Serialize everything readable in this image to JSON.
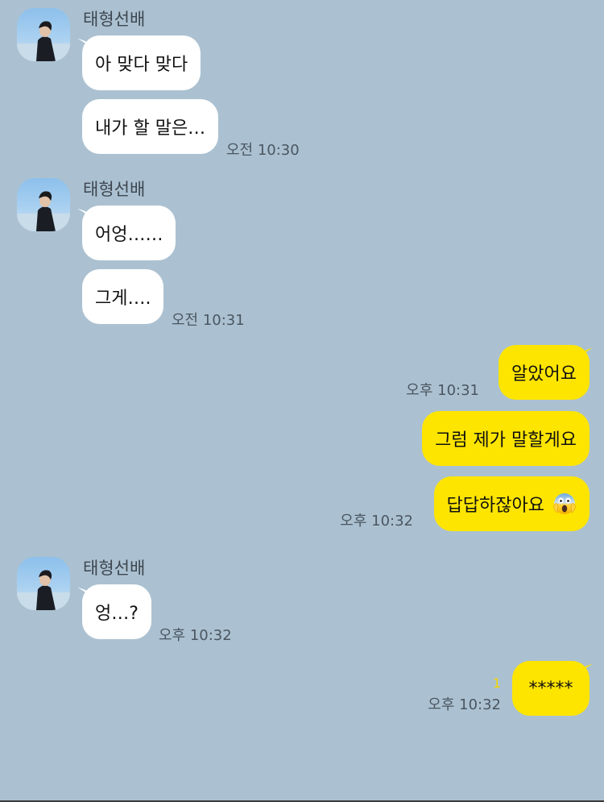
{
  "sender_name": "태형선배",
  "messages": [
    {
      "text": "아 맞다 맞다"
    },
    {
      "text": "내가 할 말은…",
      "time": "오전 10:30"
    },
    {
      "text": "어엉……"
    },
    {
      "text": "그게….",
      "time": "오전 10:31"
    },
    {
      "text": "알았어요",
      "time": "오후 10:31"
    },
    {
      "text": "그럼 제가 말할게요"
    },
    {
      "text": "답답하잖아요",
      "time": "오후 10:32",
      "emoji": "face-screaming-in-fear-icon"
    },
    {
      "text": "엉…?",
      "time": "오후 10:32"
    },
    {
      "text": "*****",
      "time": "오후 10:32",
      "unread": "1"
    }
  ],
  "colors": {
    "background": "#abc1d1",
    "incoming_bubble": "#ffffff",
    "outgoing_bubble": "#fee500",
    "unread_count": "#f5d400"
  }
}
